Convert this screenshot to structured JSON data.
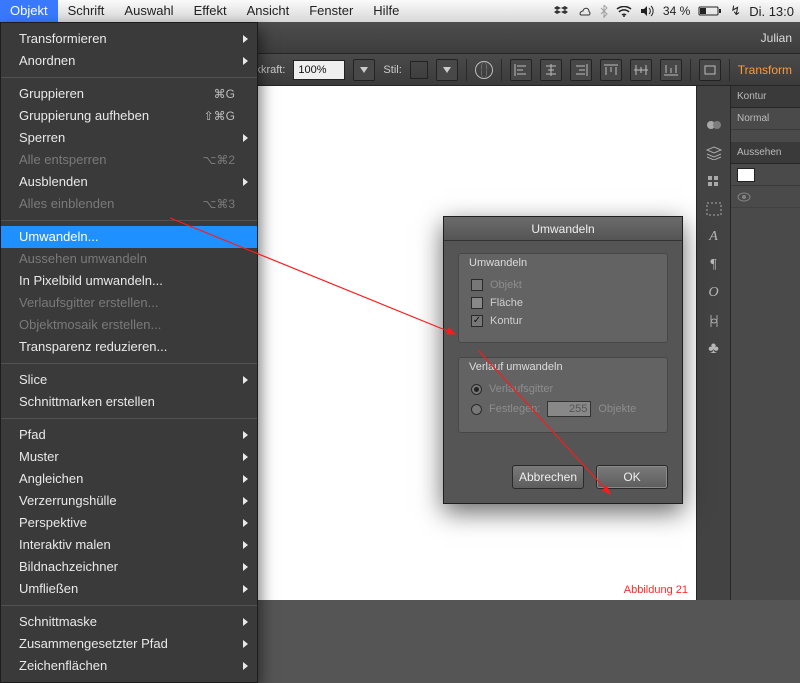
{
  "menubar": {
    "menus": [
      "Objekt",
      "Schrift",
      "Auswahl",
      "Effekt",
      "Ansicht",
      "Fenster",
      "Hilfe"
    ],
    "active_index": 0,
    "status": {
      "battery_pct": "34 %",
      "charging_glyph": "↯",
      "clock": "Di. 13:0"
    },
    "icons": [
      "dropbox",
      "cloud",
      "bluetooth",
      "wifi",
      "volume"
    ]
  },
  "doc_title": "Julian",
  "option_bar": {
    "opacity_label": "Deckkraft:",
    "opacity_value": "100%",
    "style_label": "Stil:",
    "transform_link": "Transform"
  },
  "menu": {
    "groups": [
      [
        {
          "label": "Transformieren",
          "sub": true
        },
        {
          "label": "Anordnen",
          "sub": true
        }
      ],
      [
        {
          "label": "Gruppieren",
          "shortcut": "⌘G"
        },
        {
          "label": "Gruppierung aufheben",
          "shortcut": "⇧⌘G"
        },
        {
          "label": "Sperren",
          "sub": true
        },
        {
          "label": "Alle entsperren",
          "shortcut": "⌥⌘2",
          "disabled": true
        },
        {
          "label": "Ausblenden",
          "sub": true
        },
        {
          "label": "Alles einblenden",
          "shortcut": "⌥⌘3",
          "disabled": true
        }
      ],
      [
        {
          "label": "Umwandeln...",
          "highlight": true
        },
        {
          "label": "Aussehen umwandeln",
          "disabled": true
        },
        {
          "label": "In Pixelbild umwandeln..."
        },
        {
          "label": "Verlaufsgitter erstellen...",
          "disabled": true
        },
        {
          "label": "Objektmosaik erstellen...",
          "disabled": true
        },
        {
          "label": "Transparenz reduzieren..."
        }
      ],
      [
        {
          "label": "Slice",
          "sub": true
        },
        {
          "label": "Schnittmarken erstellen"
        }
      ],
      [
        {
          "label": "Pfad",
          "sub": true
        },
        {
          "label": "Muster",
          "sub": true
        },
        {
          "label": "Angleichen",
          "sub": true
        },
        {
          "label": "Verzerrungshülle",
          "sub": true
        },
        {
          "label": "Perspektive",
          "sub": true
        },
        {
          "label": "Interaktiv malen",
          "sub": true
        },
        {
          "label": "Bildnachzeichner",
          "sub": true
        },
        {
          "label": "Umfließen",
          "sub": true
        }
      ],
      [
        {
          "label": "Schnittmaske",
          "sub": true
        },
        {
          "label": "Zusammengesetzter Pfad",
          "sub": true
        },
        {
          "label": "Zeichenflächen",
          "sub": true
        }
      ]
    ]
  },
  "dialog": {
    "title": "Umwandeln",
    "group1": {
      "legend": "Umwandeln",
      "opt_object": "Objekt",
      "opt_fill": "Fläche",
      "opt_stroke": "Kontur",
      "object_checked": false,
      "fill_checked": false,
      "stroke_checked": true
    },
    "group2": {
      "legend": "Verlauf umwandeln",
      "opt_mesh": "Verlaufsgitter",
      "opt_spec": "Festlegen:",
      "spec_value": "255",
      "spec_unit": "Objekte"
    },
    "btn_cancel": "Abbrechen",
    "btn_ok": "OK"
  },
  "right_panels": {
    "tab_stroke": "Kontur",
    "mode": "Normal",
    "tab_appearance": "Aussehen"
  },
  "rail_icons": [
    "swatches-icon",
    "layers-icon",
    "brushes-icon",
    "artboards-icon",
    "type-icon",
    "paragraph-icon",
    "ellipse-icon",
    "link-icon",
    "symbols-icon"
  ],
  "caption": "Abbildung  21"
}
